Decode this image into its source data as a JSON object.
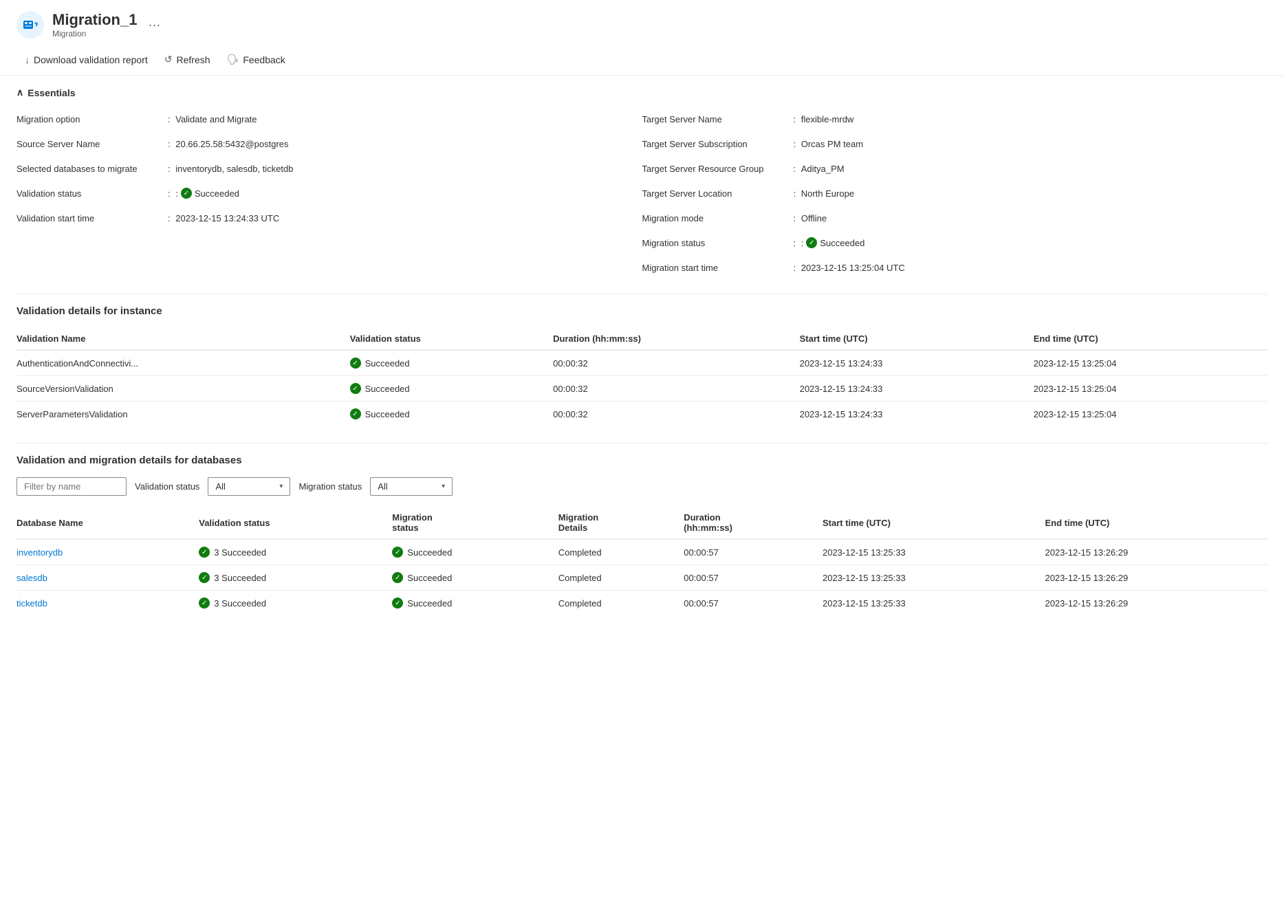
{
  "header": {
    "title": "Migration_1",
    "subtitle": "Migration",
    "more_label": "···"
  },
  "toolbar": {
    "download_label": "Download validation report",
    "refresh_label": "Refresh",
    "feedback_label": "Feedback"
  },
  "essentials": {
    "section_label": "Essentials",
    "left": [
      {
        "label": "Migration option",
        "value": "Validate and Migrate"
      },
      {
        "label": "Source Server Name",
        "value": "20.66.25.58:5432@postgres"
      },
      {
        "label": "Selected databases to migrate",
        "value": "inventorydb, salesdb, ticketdb"
      },
      {
        "label": "Validation status",
        "value": "Succeeded",
        "is_status": true
      },
      {
        "label": "Validation start time",
        "value": "2023-12-15 13:24:33 UTC"
      }
    ],
    "right": [
      {
        "label": "Target Server Name",
        "value": "flexible-mrdw"
      },
      {
        "label": "Target Server Subscription",
        "value": "Orcas PM team"
      },
      {
        "label": "Target Server Resource Group",
        "value": "Aditya_PM"
      },
      {
        "label": "Target Server Location",
        "value": "North Europe"
      },
      {
        "label": "Migration mode",
        "value": "Offline"
      },
      {
        "label": "Migration status",
        "value": "Succeeded",
        "is_status": true
      },
      {
        "label": "Migration start time",
        "value": "2023-12-15 13:25:04 UTC"
      }
    ]
  },
  "validation_details": {
    "section_title": "Validation details for instance",
    "columns": [
      "Validation Name",
      "Validation status",
      "Duration (hh:mm:ss)",
      "Start time (UTC)",
      "End time (UTC)"
    ],
    "rows": [
      {
        "name": "AuthenticationAndConnectivi...",
        "status": "Succeeded",
        "duration": "00:00:32",
        "start": "2023-12-15 13:24:33",
        "end": "2023-12-15 13:25:04"
      },
      {
        "name": "SourceVersionValidation",
        "status": "Succeeded",
        "duration": "00:00:32",
        "start": "2023-12-15 13:24:33",
        "end": "2023-12-15 13:25:04"
      },
      {
        "name": "ServerParametersValidation",
        "status": "Succeeded",
        "duration": "00:00:32",
        "start": "2023-12-15 13:24:33",
        "end": "2023-12-15 13:25:04"
      }
    ]
  },
  "migration_details": {
    "section_title": "Validation and migration details for databases",
    "filter": {
      "placeholder": "Filter by name",
      "validation_label": "Validation status",
      "validation_value": "All",
      "migration_label": "Migration status",
      "migration_value": "All"
    },
    "columns": [
      "Database Name",
      "Validation status",
      "Migration status",
      "Migration Details",
      "Duration (hh:mm:ss)",
      "Start time (UTC)",
      "End time (UTC)"
    ],
    "rows": [
      {
        "name": "inventorydb",
        "validation_status": "3 Succeeded",
        "migration_status": "Succeeded",
        "migration_details": "Completed",
        "duration": "00:00:57",
        "start": "2023-12-15 13:25:33",
        "end": "2023-12-15 13:26:29"
      },
      {
        "name": "salesdb",
        "validation_status": "3 Succeeded",
        "migration_status": "Succeeded",
        "migration_details": "Completed",
        "duration": "00:00:57",
        "start": "2023-12-15 13:25:33",
        "end": "2023-12-15 13:26:29"
      },
      {
        "name": "ticketdb",
        "validation_status": "3 Succeeded",
        "migration_status": "Succeeded",
        "migration_details": "Completed",
        "duration": "00:00:57",
        "start": "2023-12-15 13:25:33",
        "end": "2023-12-15 13:26:29"
      }
    ]
  },
  "colors": {
    "success": "#107c10",
    "link": "#0078d4"
  }
}
